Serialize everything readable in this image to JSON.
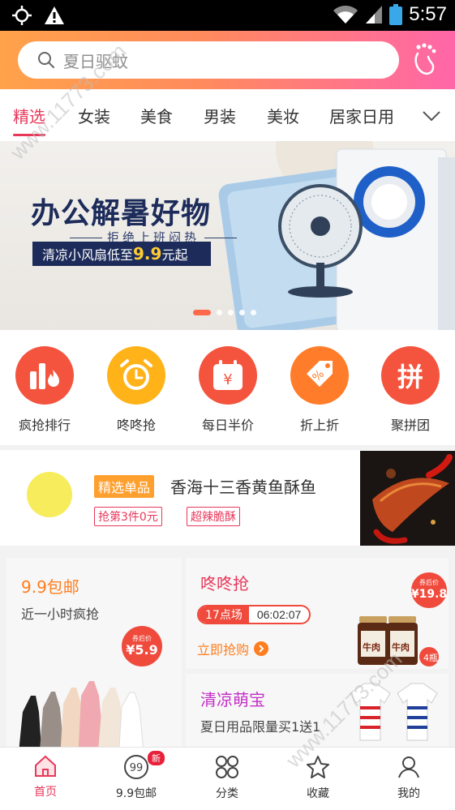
{
  "status_bar": {
    "time": "5:57"
  },
  "search": {
    "placeholder": "夏日驱蚊"
  },
  "tabs": [
    "精选",
    "女装",
    "美食",
    "男装",
    "美妆",
    "居家日用"
  ],
  "banner": {
    "title": "办公解暑好物",
    "subtitle": "拒绝上班闷热",
    "promo_prefix": "清凉小风扇低至",
    "promo_price": "9.9",
    "promo_suffix": "元起",
    "slide_count": 5,
    "active_slide": 1
  },
  "quick_links": [
    {
      "label": "疯抢排行",
      "icon": "bar-chart-flame-icon",
      "color": "#f4543e"
    },
    {
      "label": "咚咚抢",
      "icon": "alarm-clock-icon",
      "color": "#ffb319"
    },
    {
      "label": "每日半价",
      "icon": "calendar-yen-icon",
      "color": "#f4543e"
    },
    {
      "label": "折上折",
      "icon": "discount-tag-icon",
      "color": "#ff7d2a"
    },
    {
      "label": "聚拼团",
      "icon": "group-buy-icon",
      "color": "#f4543e"
    }
  ],
  "featured": {
    "tag": "精选单品",
    "title": "香海十三香黄鱼酥鱼",
    "chips": [
      "抢第3件0元",
      "超辣脆酥"
    ]
  },
  "promo_cards": {
    "card_99": {
      "title": "9.9包邮",
      "subtitle": "近一小时疯抢",
      "badge_label": "券后价",
      "badge_price": "¥5.9"
    },
    "flash_sale": {
      "title": "咚咚抢",
      "slot": "17点场",
      "countdown": "06:02:07",
      "cta": "立即抢购",
      "badge_label": "券后价",
      "badge_price": "¥19.8",
      "product_label": "牛肉",
      "count_label": "4瓶"
    },
    "baby": {
      "title": "清凉萌宝",
      "subtitle": "夏日用品限量买1送1"
    }
  },
  "bottom_nav": [
    {
      "label": "首页",
      "icon": "home-icon",
      "active": true
    },
    {
      "label": "9.9包邮",
      "icon": "nine-nine-icon",
      "badge": "新"
    },
    {
      "label": "分类",
      "icon": "category-grid-icon"
    },
    {
      "label": "收藏",
      "icon": "star-icon"
    },
    {
      "label": "我的",
      "icon": "user-icon"
    }
  ],
  "watermark": "www.11773.com",
  "colors": {
    "accent": "#e8375a",
    "orange": "#ff7d1e",
    "header_start": "#ffa24a",
    "header_end": "#ff66a8"
  }
}
